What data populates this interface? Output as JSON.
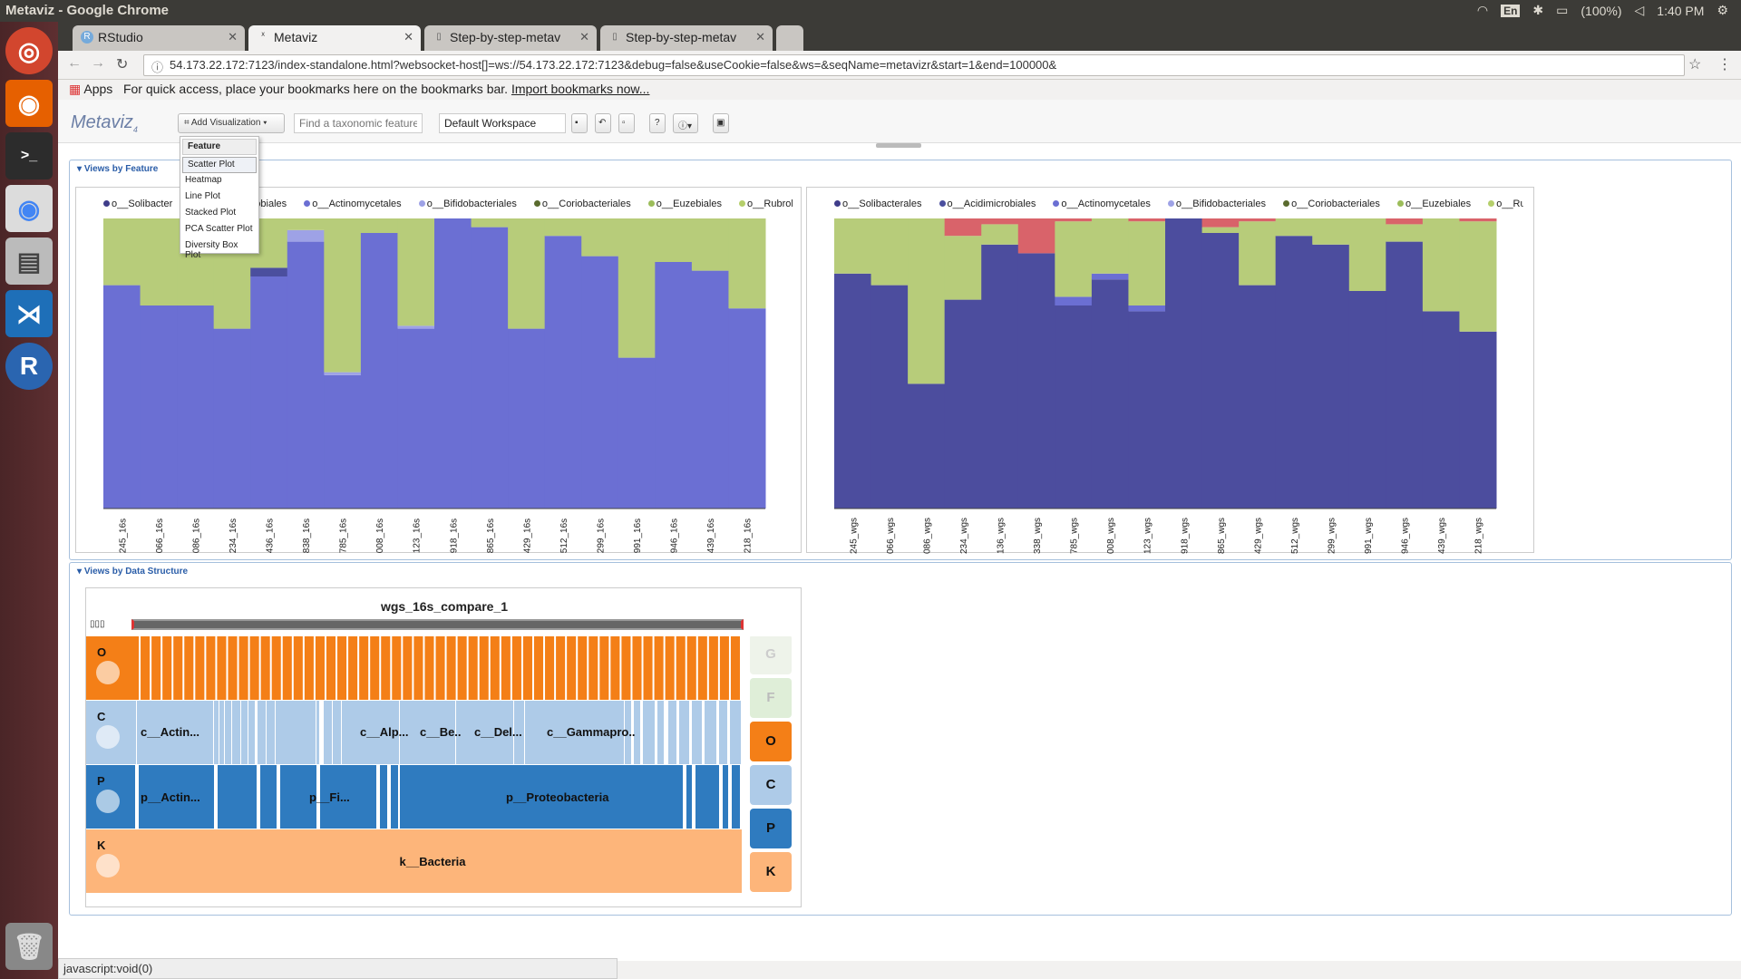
{
  "window_title": "Metaviz - Google Chrome",
  "tray": {
    "lang": "En",
    "battery": "(100%)",
    "time": "1:40 PM"
  },
  "tabs": [
    {
      "label": "RStudio"
    },
    {
      "label": "Metaviz"
    },
    {
      "label": "Step-by-step-metav"
    },
    {
      "label": "Step-by-step-metav"
    }
  ],
  "url": "54.173.22.172:7123/index-standalone.html?websocket-host[]=ws://54.173.22.172:7123&debug=false&useCookie=false&ws=&seqName=metavizr&start=1&end=100000&",
  "bookmarks": {
    "apps": "Apps",
    "text": "For quick access, place your bookmarks here on the bookmarks bar.",
    "link": "Import bookmarks now..."
  },
  "app": {
    "logo": "Metaviz",
    "add_visualization": "Add Visualization",
    "search_placeholder": "Find a taxonomic feature",
    "workspace": "Default Workspace"
  },
  "dropdown": {
    "header": "Feature",
    "items": [
      "Scatter Plot",
      "Heatmap",
      "Line Plot",
      "Stacked Plot",
      "PCA Scatter Plot",
      "Diversity Box Plot"
    ]
  },
  "sections": {
    "feature": "Views by Feature",
    "data": "Views by Data Structure"
  },
  "colors": {
    "Solibacterales": "#3f3d8a",
    "Acidimicrobiales": "#4b4f9e",
    "Actinomycetales": "#6b6fd3",
    "Bifidobacteriales": "#9ea2e6",
    "Coriobacteriales": "#5a6b2e",
    "Euzebiales": "#9cbd5a",
    "Rubrobacterales": "#b5cf6b"
  },
  "chart_data": [
    {
      "type": "area",
      "legend": [
        "o__Solibacterales",
        "o__Acidimicrobiales",
        "o__Actinomycetales",
        "o__Bifidobacteriales",
        "o__Coriobacteriales",
        "o__Euzebiales",
        "o__Rubrobacterales"
      ],
      "legend_visible": [
        "o__Solibacter",
        "o__Acidimicrobiales",
        "o__Actinomycetales",
        "o__Bifidobacteriales",
        "o__Coriobacteriales",
        "o__Euzebiales",
        "o__Rubroba"
      ],
      "categories": [
        "245_16s",
        "066_16s",
        "086_16s",
        "234_16s",
        "436_16s",
        "838_16s",
        "785_16s",
        "008_16s",
        "123_16s",
        "918_16s",
        "865_16s",
        "429_16s",
        "512_16s",
        "299_16s",
        "991_16s",
        "946_16s",
        "439_16s",
        "218_16s"
      ],
      "series": [
        {
          "name": "o__Actinomycetales",
          "values": [
            0.77,
            0.7,
            0.7,
            0.62,
            0.8,
            0.92,
            0.46,
            0.95,
            0.62,
            1.0,
            0.97,
            0.62,
            0.94,
            0.87,
            0.52,
            0.85,
            0.82,
            0.69
          ]
        },
        {
          "name": "o__Bifidobacteriales",
          "values": [
            0.0,
            0.0,
            0.0,
            0.0,
            0.0,
            0.04,
            0.01,
            0.0,
            0.01,
            0.0,
            0.0,
            0.0,
            0.0,
            0.0,
            0.0,
            0.0,
            0.0,
            0.0
          ]
        },
        {
          "name": "o__Acidimicrobiales",
          "values": [
            0.0,
            0.0,
            0.0,
            0.0,
            0.03,
            0.0,
            0.0,
            0.0,
            0.0,
            0.0,
            0.0,
            0.0,
            0.0,
            0.0,
            0.0,
            0.0,
            0.0,
            0.0
          ]
        },
        {
          "name": "o__Euzebiales",
          "values": [
            0.23,
            0.3,
            0.3,
            0.38,
            0.17,
            0.04,
            0.53,
            0.05,
            0.37,
            0.0,
            0.03,
            0.38,
            0.06,
            0.13,
            0.48,
            0.15,
            0.18,
            0.31
          ]
        }
      ],
      "ylim": [
        0,
        1
      ]
    },
    {
      "type": "area",
      "legend": [
        "o__Solibacterales",
        "o__Acidimicrobiales",
        "o__Actinomycetales",
        "o__Bifidobacteriales",
        "o__Coriobacteriales",
        "o__Euzebiales",
        "o__Rubrobacterales"
      ],
      "legend_visible": [
        "o__Solibacterales",
        "o__Acidimicrobiales",
        "o__Actinomycetales",
        "o__Bifidobacteriales",
        "o__Coriobacteriales",
        "o__Euzebiales",
        "o__Rubroba"
      ],
      "categories": [
        "245_wgs",
        "066_wgs",
        "086_wgs",
        "234_wgs",
        "136_wgs",
        "338_wgs",
        "785_wgs",
        "008_wgs",
        "123_wgs",
        "918_wgs",
        "865_wgs",
        "429_wgs",
        "512_wgs",
        "299_wgs",
        "991_wgs",
        "946_wgs",
        "439_wgs",
        "218_wgs"
      ],
      "series": [
        {
          "name": "o__Acidimicrobiales",
          "values": [
            0.81,
            0.77,
            0.43,
            0.72,
            0.91,
            0.88,
            0.7,
            0.79,
            0.68,
            1.0,
            0.95,
            0.77,
            0.94,
            0.91,
            0.75,
            0.92,
            0.68,
            0.61
          ]
        },
        {
          "name": "o__Actinomycetales",
          "values": [
            0.0,
            0.0,
            0.0,
            0.0,
            0.0,
            0.0,
            0.03,
            0.02,
            0.02,
            0.0,
            0.0,
            0.0,
            0.0,
            0.0,
            0.0,
            0.0,
            0.0,
            0.0
          ]
        },
        {
          "name": "o__Euzebiales",
          "values": [
            0.19,
            0.23,
            0.57,
            0.22,
            0.07,
            0.0,
            0.26,
            0.19,
            0.29,
            0.0,
            0.02,
            0.22,
            0.06,
            0.09,
            0.25,
            0.06,
            0.32,
            0.38
          ]
        },
        {
          "name": "o__Coriobacteriales",
          "values": [
            0.0,
            0.0,
            0.0,
            0.06,
            0.02,
            0.12,
            0.01,
            0.0,
            0.01,
            0.0,
            0.03,
            0.01,
            0.0,
            0.0,
            0.0,
            0.02,
            0.0,
            0.01
          ]
        }
      ],
      "ylim": [
        0,
        1
      ]
    }
  ],
  "icicle": {
    "title": "wgs_16s_compare_1",
    "levels": [
      "O",
      "C",
      "P",
      "K"
    ],
    "right_buttons": [
      "G",
      "F",
      "O",
      "C",
      "P",
      "K"
    ],
    "class_labels": [
      "c__Actin...",
      "c__Alp...",
      "c__Be..",
      "c__Del...",
      "c__Gammapro.."
    ],
    "phylum_labels": [
      "p__Actin...",
      "p__Fi...",
      "p__Proteobacteria"
    ],
    "kingdom_label": "k__Bacteria"
  },
  "status": "javascript:void(0)"
}
